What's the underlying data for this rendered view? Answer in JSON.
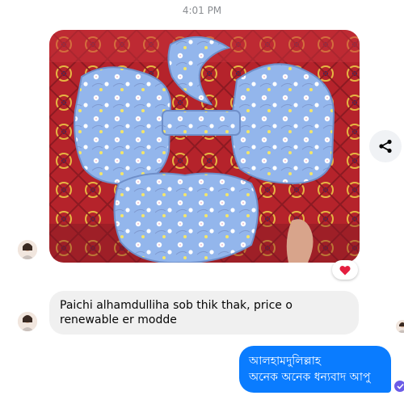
{
  "chat": {
    "timestamp": "4:01 PM",
    "photo": {
      "alt": "Blue floral pregnancy pillow set"
    },
    "reaction": {
      "icon": "heart-icon",
      "color": "#e41e3f"
    },
    "messages": {
      "incoming_text": "Paichi alhamdulliha sob thik thak, price o renewable er modde",
      "outgoing_line1": "আলহামদুলিল্লাহ",
      "outgoing_line2": "অনেক অনেক ধন্যবাদ আপু"
    },
    "share_icon": "share-icon",
    "colors": {
      "outgoing_bubble": "#0a7cff",
      "incoming_bubble": "#f0f0f0",
      "pillow_blue": "#8fb4ea",
      "background_red": "#b3262d"
    }
  }
}
